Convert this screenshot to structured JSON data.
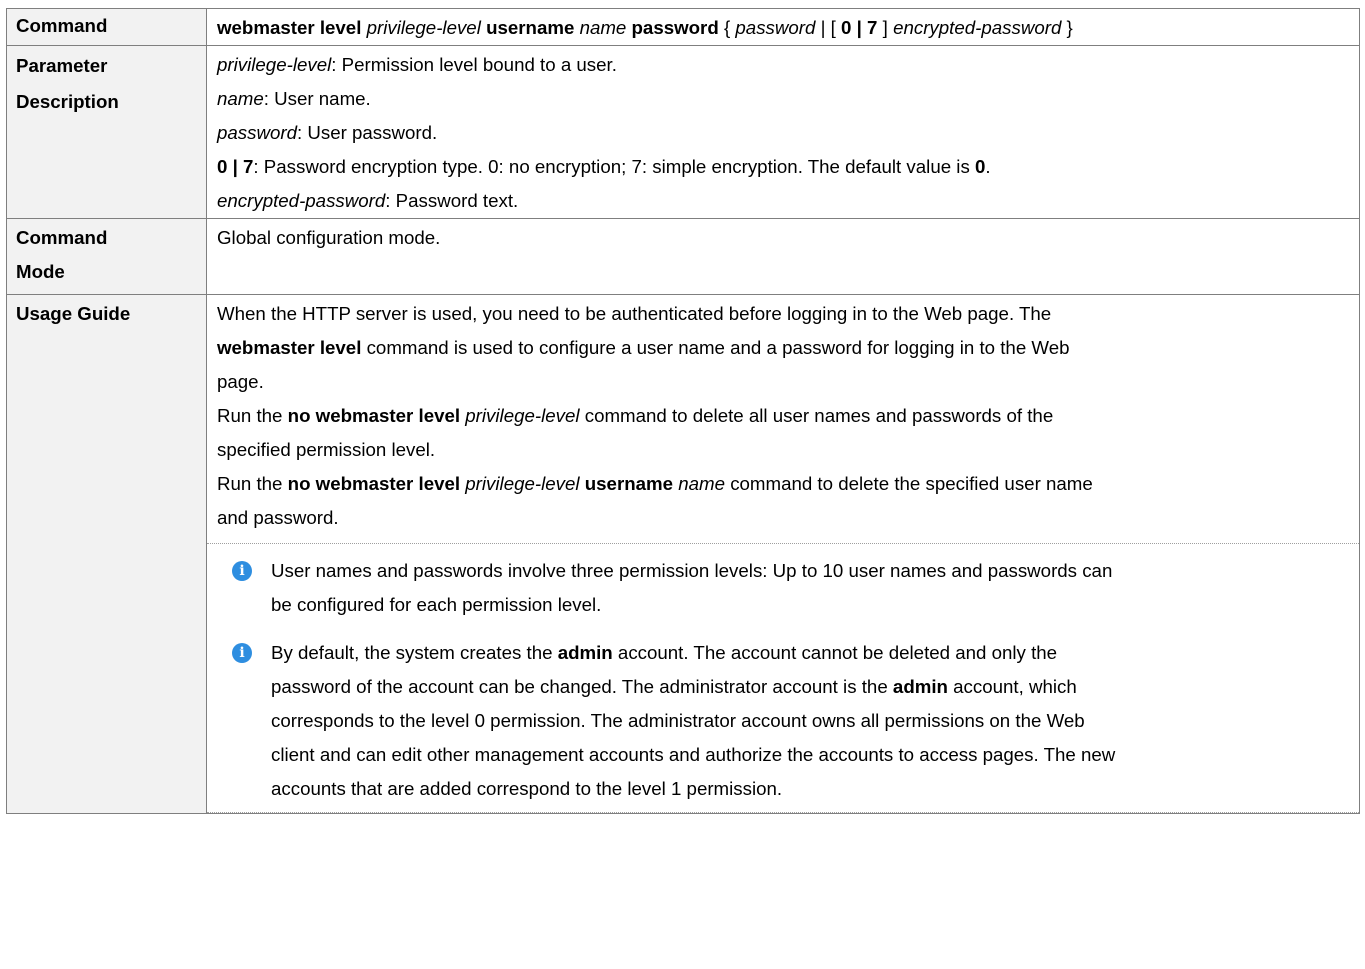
{
  "rows": {
    "command": {
      "label": "Command",
      "syntax": {
        "kw1": "webmaster level",
        "arg1": "privilege-level",
        "kw2": "username",
        "arg2": "name",
        "kw3": "password",
        "brace_open": "{",
        "arg3": "password",
        "pipe_bracket": "| [",
        "kw4": "0 | 7",
        "bracket_close": "]",
        "arg4": "encrypted-password",
        "brace_close": "}"
      }
    },
    "param": {
      "label_line1": "Parameter",
      "label_line2": "Description",
      "items": [
        {
          "term": "privilege-level",
          "text": ": Permission level bound to a user."
        },
        {
          "term": "name",
          "text": ": User name."
        },
        {
          "term": "password",
          "text": ": User password."
        },
        {
          "term": "0 | 7",
          "text": ": Password encryption type. 0: no encryption; 7: simple encryption. The default value is ",
          "tail_bold": "0",
          "tail": "."
        },
        {
          "term": "encrypted-password",
          "text": ": Password text."
        }
      ]
    },
    "mode": {
      "label_line1": "Command",
      "label_line2": "Mode",
      "text": "Global configuration mode."
    },
    "usage": {
      "label": "Usage Guide",
      "p1": "When the HTTP server is used, you need to be authenticated before logging in to the Web page. The",
      "p1_bold": "webmaster level",
      "p1_rest1": " command is used to configure a user name and a password for logging in to the Web",
      "p1_rest2": "page.",
      "p2_pre": "Run the ",
      "p2_bold": "no webmaster level",
      "p2_ital": "privilege-level",
      "p2_rest1": " command to delete all user names and passwords of the",
      "p2_rest2": "specified permission level.",
      "p3_pre": "Run the ",
      "p3_bold1": "no webmaster level",
      "p3_ital1": "privilege-level",
      "p3_bold2": "username",
      "p3_ital2": "name",
      "p3_rest1": " command to delete the specified user name",
      "p3_rest2": "and password.",
      "note1_line1": "User names and passwords involve three permission levels: Up to 10 user names and passwords can",
      "note1_line2": "be configured for each permission level.",
      "note2_l1_pre": "By default, the system creates the ",
      "note2_l1_bold": "admin",
      "note2_l1_post": " account. The account cannot be deleted and only the",
      "note2_l2_pre": "password of the account can be changed. The administrator account is the ",
      "note2_l2_bold": "admin",
      "note2_l2_post": " account, which",
      "note2_l3": "corresponds to the level 0 permission. The administrator account owns all permissions on the Web",
      "note2_l4": "client and can edit other management accounts and authorize the accounts to access pages. The new",
      "note2_l5": "accounts that are added correspond to the level 1 permission."
    }
  },
  "icons": {
    "note": "info-icon",
    "glyph": "i",
    "color": "#2e8ee0"
  }
}
